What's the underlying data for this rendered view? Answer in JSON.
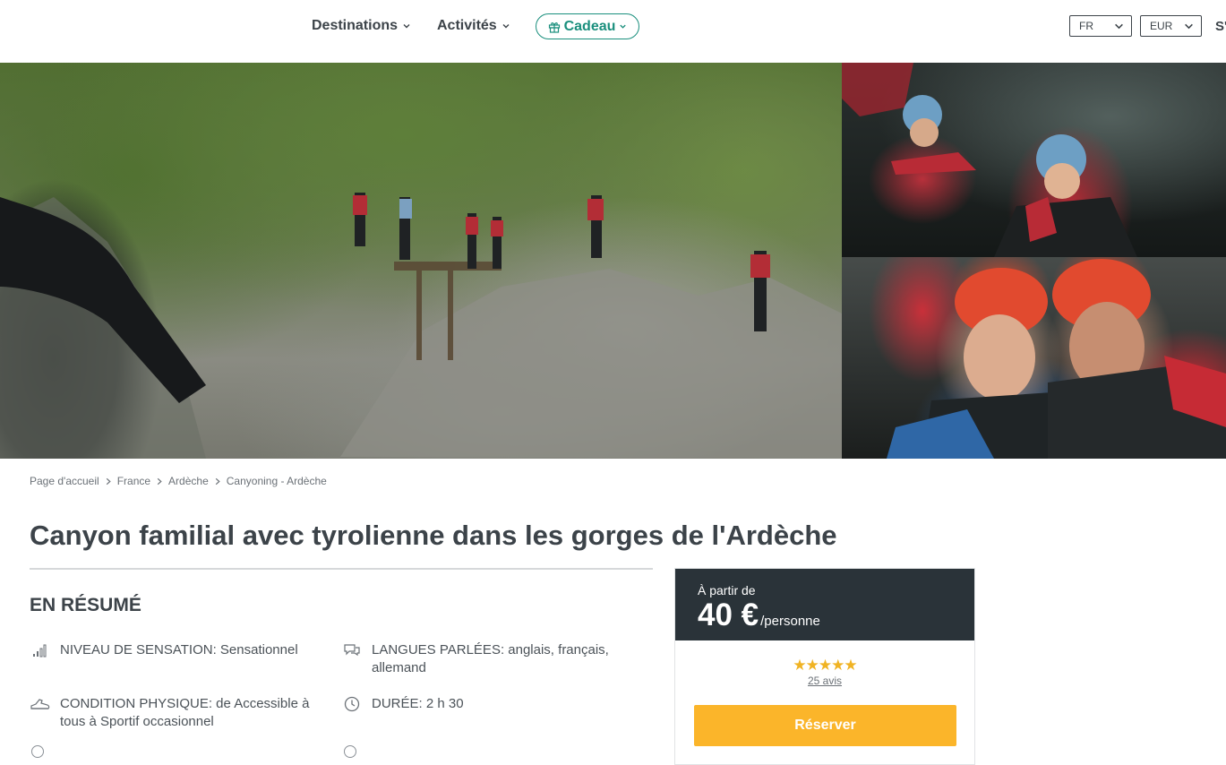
{
  "header": {
    "nav": [
      {
        "label": "Destinations"
      },
      {
        "label": "Activités"
      }
    ],
    "gift_label": "Cadeau",
    "language": "FR",
    "currency": "EUR",
    "cut_link": "S'"
  },
  "breadcrumb": [
    "Page d'accueil",
    "France",
    "Ardèche",
    "Canyoning - Ardèche"
  ],
  "title": "Canyon familial avec tyrolienne dans les gorges de l'Ardèche",
  "summary": {
    "heading": "EN RÉSUMÉ",
    "features": [
      {
        "icon": "signal-bars-icon",
        "text": "NIVEAU DE SENSATION: Sensationnel"
      },
      {
        "icon": "speech-bubbles-icon",
        "text": "LANGUES PARLÉES: anglais, français, allemand"
      },
      {
        "icon": "sneaker-icon",
        "text": "CONDITION PHYSIQUE: de Accessible à tous à Sportif occasionnel"
      },
      {
        "icon": "clock-icon",
        "text": "DURÉE: 2 h 30"
      }
    ]
  },
  "booking": {
    "from_label": "À partir de",
    "price": "40 €",
    "per_label": "/personne",
    "stars": "★★★★★",
    "rating": 5,
    "reviews_label": "25 avis",
    "book_label": "Réserver"
  },
  "colors": {
    "accent_green": "#1a8f7d",
    "price_bg": "#2a3339",
    "cta": "#fbb52a",
    "stars": "#f0b323"
  }
}
